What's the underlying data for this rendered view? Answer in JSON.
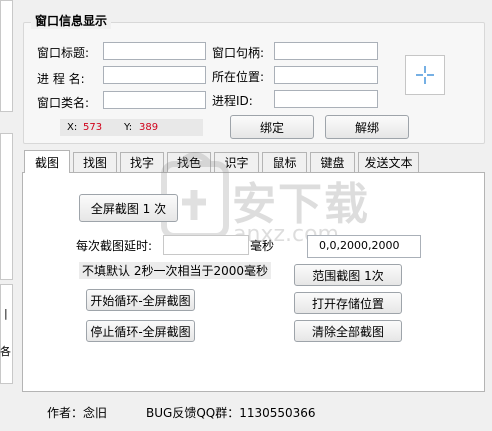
{
  "window_info": {
    "title": "窗口信息显示",
    "labels": {
      "window_title": "窗口标题:",
      "process_name": "进 程 名:",
      "window_class": "窗口类名:",
      "window_handle": "窗口句柄:",
      "location": "所在位置:",
      "process_id": "进程ID:"
    },
    "values": {
      "window_title": "",
      "process_name": "",
      "window_class": "",
      "window_handle": "",
      "location": "",
      "process_id": ""
    },
    "crosshair_icon": "crosshair-icon",
    "coords": {
      "x_label": "X:",
      "x_value": "573",
      "y_label": "Y:",
      "y_value": "389"
    },
    "bind_button": "绑定",
    "unbind_button": "解绑"
  },
  "tabs": [
    {
      "label": "截图",
      "active": true
    },
    {
      "label": "找图",
      "active": false
    },
    {
      "label": "找字",
      "active": false
    },
    {
      "label": "找色",
      "active": false
    },
    {
      "label": "识字",
      "active": false
    },
    {
      "label": "鼠标",
      "active": false
    },
    {
      "label": "键盘",
      "active": false
    },
    {
      "label": "发送文本",
      "active": false
    }
  ],
  "screenshot_tab": {
    "fullscreen_button": "全屏截图 1 次",
    "delay_label": "每次截图延时:",
    "delay_value": "",
    "delay_unit": "毫秒",
    "region_value": "0,0,2000,2000",
    "hint_text": "不填默认 2秒一次相当于2000毫秒",
    "region_button": "范围截图 1次",
    "start_loop_button": "开始循环-全屏截图",
    "open_folder_button": "打开存储位置",
    "stop_loop_button": "停止循环-全屏截图",
    "clear_all_button": "清除全部截图"
  },
  "footer": {
    "author": "作者：念旧",
    "bug_feedback": "BUG反馈QQ群：1130550366"
  },
  "left_edge": {
    "char1": "|",
    "char2": "各"
  },
  "watermark": {
    "text_cn": "安下载",
    "text_en": "anxz.com"
  },
  "colors": {
    "coord_value": "#d0021b",
    "crosshair": "#3a8fd8",
    "tab_border": "#b4b4b4"
  }
}
